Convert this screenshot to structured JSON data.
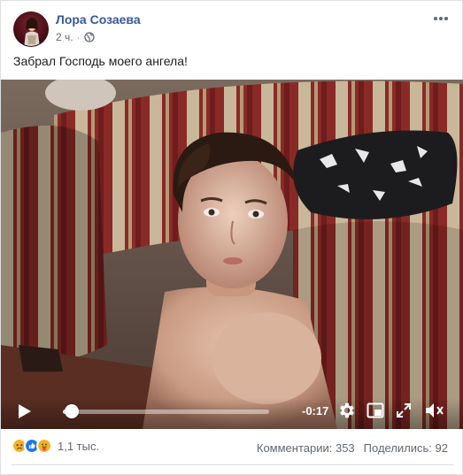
{
  "post": {
    "author_name": "Лора Созаева",
    "time_ago": "2 ч.",
    "separator": "·",
    "privacy_icon": "globe-icon",
    "more_icon": "more-options-icon",
    "text": "Забрал Господь моего ангела!"
  },
  "video": {
    "time_remaining": "-0:17",
    "progress": 0.01,
    "controls": {
      "play": "play-icon",
      "settings": "gear-icon",
      "pip": "picture-in-picture-icon",
      "fullscreen": "fullscreen-icon",
      "volume": "muted-volume-icon"
    }
  },
  "footer": {
    "reaction_icons": [
      "sad-reaction-icon",
      "like-reaction-icon",
      "care-reaction-icon"
    ],
    "reaction_count": "1,1 тыс.",
    "comments": "Комментарии: 353",
    "shares": "Поделились: 92"
  },
  "colors": {
    "author_link": "#385898",
    "secondary_text": "#606770",
    "like_blue": "#1877f2",
    "sad_yellow": "#f7b125"
  }
}
